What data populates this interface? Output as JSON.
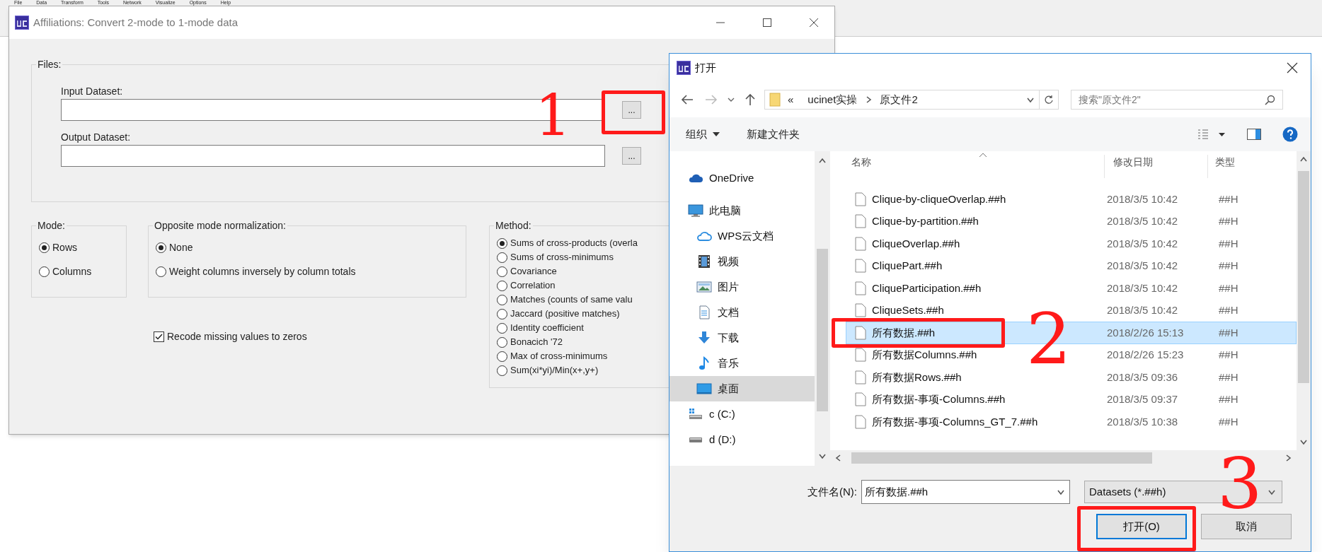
{
  "menu_bar": [
    "File",
    "Data",
    "Transform",
    "Tools",
    "Network",
    "Visualize",
    "Options",
    "Help"
  ],
  "affiliations_dialog": {
    "title": "Affiliations: Convert 2-mode to 1-mode data",
    "files_group": {
      "label": "Files:",
      "fields": [
        {
          "label": "Input Dataset:",
          "button": "..."
        },
        {
          "label": "Output Dataset:",
          "button": "..."
        }
      ]
    },
    "mode": {
      "label": "Mode:",
      "options": [
        {
          "label": "Rows",
          "selected": true
        },
        {
          "label": "Columns",
          "selected": false
        }
      ]
    },
    "normalization": {
      "label": "Opposite mode normalization:",
      "options": [
        {
          "label": "None",
          "selected": true
        },
        {
          "label": "Weight columns inversely by column totals",
          "selected": false
        }
      ]
    },
    "recode_missing": {
      "label": "Recode missing values to zeros",
      "checked": true
    },
    "method": {
      "label": "Method:",
      "options": [
        {
          "label": "Sums of cross-products (overla",
          "selected": true
        },
        {
          "label": "Sums of cross-minimums",
          "selected": false
        },
        {
          "label": "Covariance",
          "selected": false
        },
        {
          "label": "Correlation",
          "selected": false
        },
        {
          "label": "Matches (counts of same valu",
          "selected": false
        },
        {
          "label": "Jaccard (positive matches)",
          "selected": false
        },
        {
          "label": "Identity coefficient",
          "selected": false
        },
        {
          "label": "Bonacich '72",
          "selected": false
        },
        {
          "label": "Max of cross-minimums",
          "selected": false
        },
        {
          "label": "Sum(xi*yi)/Min(x+,y+)",
          "selected": false
        }
      ]
    }
  },
  "open_dialog": {
    "title": "打开",
    "breadcrumb": [
      "«",
      "ucinet实操",
      "原文件2"
    ],
    "search_placeholder": "搜索\"原文件2\"",
    "toolbar": {
      "organize": "组织",
      "new_folder": "新建文件夹"
    },
    "nav_items": [
      {
        "label": "OneDrive",
        "kind": "cloud",
        "selected": false
      },
      {
        "label": "此电脑",
        "kind": "computer",
        "selected": false
      },
      {
        "label": "WPS云文档",
        "kind": "cloud-outline",
        "selected": false
      },
      {
        "label": "视频",
        "kind": "video",
        "selected": false
      },
      {
        "label": "图片",
        "kind": "picture",
        "selected": false
      },
      {
        "label": "文档",
        "kind": "document",
        "selected": false
      },
      {
        "label": "下载",
        "kind": "download",
        "selected": false
      },
      {
        "label": "音乐",
        "kind": "music",
        "selected": false
      },
      {
        "label": "桌面",
        "kind": "desktop",
        "selected": true
      },
      {
        "label": "c (C:)",
        "kind": "drive-c",
        "selected": false
      },
      {
        "label": "d (D:)",
        "kind": "drive",
        "selected": false
      }
    ],
    "columns": [
      "名称",
      "修改日期",
      "类型"
    ],
    "files": [
      {
        "name": "Clique-by-cliqueOverlap.##h",
        "modified": "2018/3/5 10:42",
        "type": "##H",
        "selected": false
      },
      {
        "name": "Clique-by-partition.##h",
        "modified": "2018/3/5 10:42",
        "type": "##H",
        "selected": false
      },
      {
        "name": "CliqueOverlap.##h",
        "modified": "2018/3/5 10:42",
        "type": "##H",
        "selected": false
      },
      {
        "name": "CliquePart.##h",
        "modified": "2018/3/5 10:42",
        "type": "##H",
        "selected": false
      },
      {
        "name": "CliqueParticipation.##h",
        "modified": "2018/3/5 10:42",
        "type": "##H",
        "selected": false
      },
      {
        "name": "CliqueSets.##h",
        "modified": "2018/3/5 10:42",
        "type": "##H",
        "selected": false
      },
      {
        "name": "所有数据.##h",
        "modified": "2018/2/26 15:13",
        "type": "##H",
        "selected": true
      },
      {
        "name": "所有数据Columns.##h",
        "modified": "2018/2/26 15:23",
        "type": "##H",
        "selected": false
      },
      {
        "name": "所有数据Rows.##h",
        "modified": "2018/3/5 09:36",
        "type": "##H",
        "selected": false
      },
      {
        "name": "所有数据-事项-Columns.##h",
        "modified": "2018/3/5 09:37",
        "type": "##H",
        "selected": false
      },
      {
        "name": "所有数据-事项-Columns_GT_7.##h",
        "modified": "2018/3/5 10:38",
        "type": "##H",
        "selected": false
      }
    ],
    "filename_label": "文件名(N):",
    "filename_value": "所有数据.##h",
    "filter": "Datasets (*.##h)",
    "buttons": [
      {
        "label": "打开(O)",
        "default": true
      },
      {
        "label": "取消",
        "default": false
      }
    ]
  },
  "annotations": [
    "1",
    "2",
    "3"
  ]
}
